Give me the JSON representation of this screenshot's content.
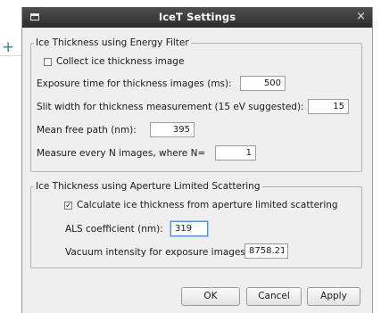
{
  "background": {
    "plus_glyph": "+"
  },
  "window": {
    "title": "IceT Settings",
    "close_glyph": "×"
  },
  "energy_filter": {
    "group_title": "Ice Thickness using Energy Filter",
    "collect_label": "Collect ice thickness image",
    "collect_checked": false,
    "exposure_label": "Exposure time for thickness images (ms):",
    "exposure_value": "500",
    "slit_label": "Slit width for thickness measurement (15 eV suggested):",
    "slit_value": "15",
    "mfp_label": "Mean free path (nm):",
    "mfp_value": "395",
    "every_n_label": "Measure every N images, where N=",
    "every_n_value": "1"
  },
  "aperture": {
    "group_title": "Ice Thickness using Aperture Limited Scattering",
    "calculate_label": "Calculate ice thickness from aperture limited scattering",
    "calculate_checked": true,
    "als_label": "ALS coefficient (nm):",
    "als_value": "319",
    "vacuum_label": "Vacuum intensity for exposure images:",
    "vacuum_value": "8758.21"
  },
  "buttons": {
    "ok": "OK",
    "cancel": "Cancel",
    "apply": "Apply"
  },
  "colors": {
    "titlebar": "#3a3a3a",
    "dialog_bg": "#efefef",
    "focus_ring": "#5a8fd0",
    "background_plus": "#3a7f8a"
  }
}
